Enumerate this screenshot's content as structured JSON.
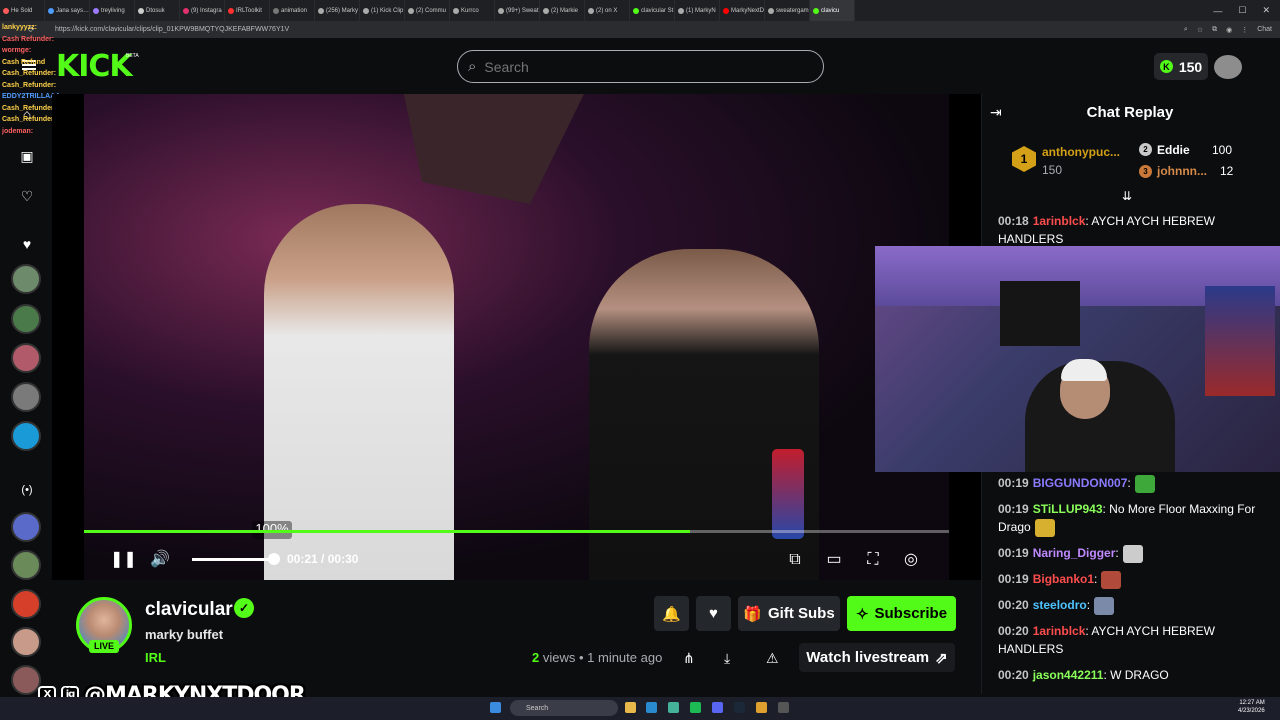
{
  "browser": {
    "tabs": [
      {
        "label": "He Sold",
        "color": "#ff5a5a"
      },
      {
        "label": "Jana says…",
        "color": "#4f9cff"
      },
      {
        "label": "treyliving",
        "color": "#9a7bff"
      },
      {
        "label": "Dtosuk",
        "color": "#cccccc"
      },
      {
        "label": "(9) Instagra",
        "color": "#e1306c"
      },
      {
        "label": "IRLToolkit",
        "color": "#ff3030"
      },
      {
        "label": "animation",
        "color": "#777777"
      },
      {
        "label": "(256) Marky",
        "color": "#aaaaaa"
      },
      {
        "label": "(1) Kick Clip",
        "color": "#aaaaaa"
      },
      {
        "label": "(2) Commu",
        "color": "#aaaaaa"
      },
      {
        "label": "Kurrco",
        "color": "#aaaaaa"
      },
      {
        "label": "(99+) Sweat",
        "color": "#aaaaaa"
      },
      {
        "label": "(2) Markie",
        "color": "#aaaaaa"
      },
      {
        "label": "(2) on X",
        "color": "#aaaaaa"
      },
      {
        "label": "clavicular St",
        "color": "#53fc18"
      },
      {
        "label": "(1) MarkyN",
        "color": "#aaaaaa"
      },
      {
        "label": "MarkyNextD",
        "color": "#ff0000"
      },
      {
        "label": "sweatergam",
        "color": "#aaaaaa"
      },
      {
        "label": "clavicu",
        "color": "#53fc18"
      }
    ],
    "url": "https://kick.com/clavicular/clips/clip_01KPW9BMQTYQJKEFABFWW76Y1V",
    "chat_btn": "Chat"
  },
  "header": {
    "logo": "KICK",
    "logo_badge": "BETA",
    "search_placeholder": "Search",
    "kicks_balance": "150"
  },
  "overlay_chat": [
    {
      "user": "lankyyyzz:",
      "color": "#ffd24a"
    },
    {
      "user": "Cash Refunder:",
      "color": "#ff6060"
    },
    {
      "user": "wormge:",
      "color": "#ff6060"
    },
    {
      "user": "Cash Refund",
      "color": "#ffd24a"
    },
    {
      "user": "Cash_Refunder:",
      "color": "#ffd24a"
    },
    {
      "user": "Cash_Refunder:",
      "color": "#ffd24a"
    },
    {
      "user": "EDDY2TRILLAAA:",
      "color": "#4f9cff"
    },
    {
      "user": "Cash_Refunder:",
      "color": "#ffd24a"
    },
    {
      "user": "Cash_Refunder:",
      "color": "#ffd24a"
    },
    {
      "user": "jodeman:",
      "color": "#ff6060"
    }
  ],
  "player": {
    "volume_badge": "100%",
    "progress": 0.7,
    "time_current": "00:21",
    "time_total": "00:30"
  },
  "channel": {
    "name": "clavicular",
    "live_badge": "LIVE",
    "clip_title": "marky buffet",
    "category": "IRL",
    "views_count": "2",
    "views_label": " views",
    "time_ago": "• 1 minute ago",
    "gift_subs_label": "Gift Subs",
    "subscribe_label": "Subscribe",
    "watch_livestream_label": "Watch livestream"
  },
  "chat": {
    "title": "Chat Replay",
    "leaderboard": {
      "first": {
        "rank": "1",
        "name": "anthonypuc...",
        "amount": "150"
      },
      "second": {
        "rank": "2",
        "name": "Eddie",
        "amount": "100"
      },
      "third": {
        "rank": "3",
        "name": "johnnn...",
        "amount": "12"
      }
    },
    "messages": [
      {
        "ts": "00:18",
        "user": "1arinblck",
        "color": "#ff4d4d",
        "text": ": AYCH AYCH HEBREW HANDLERS"
      },
      {
        "ts": "00:19",
        "user": "BIGGUNDON007",
        "color": "#8a7bff",
        "text": ":"
      },
      {
        "ts": "00:19",
        "user": "STiLLUP943",
        "color": "#8aff5a",
        "text": ": No More Floor Maxxing For Drago"
      },
      {
        "ts": "00:19",
        "user": "Naring_Digger",
        "color": "#c08aff",
        "text": ":"
      },
      {
        "ts": "00:19",
        "user": "Bigbanko1",
        "color": "#ff4d4d",
        "text": ":"
      },
      {
        "ts": "00:20",
        "user": "steelodro",
        "color": "#4fc3ff",
        "text": ":"
      },
      {
        "ts": "00:20",
        "user": "1arinblck",
        "color": "#ff4d4d",
        "text": ": AYCH AYCH HEBREW HANDLERS"
      },
      {
        "ts": "00:20",
        "user": "jason442211",
        "color": "#8aff5a",
        "text": ": W DRAGO"
      }
    ]
  },
  "watermark": {
    "x_icon": "X",
    "ig_icon": "ig",
    "handle": "@MARKYNXTDOOR"
  },
  "taskbar": {
    "search": "Search",
    "time": "12:27 AM",
    "date": "4/23/2026"
  },
  "colors": {
    "accent": "#53fc18",
    "background": "#0b0d0f",
    "button": "#24272c"
  }
}
